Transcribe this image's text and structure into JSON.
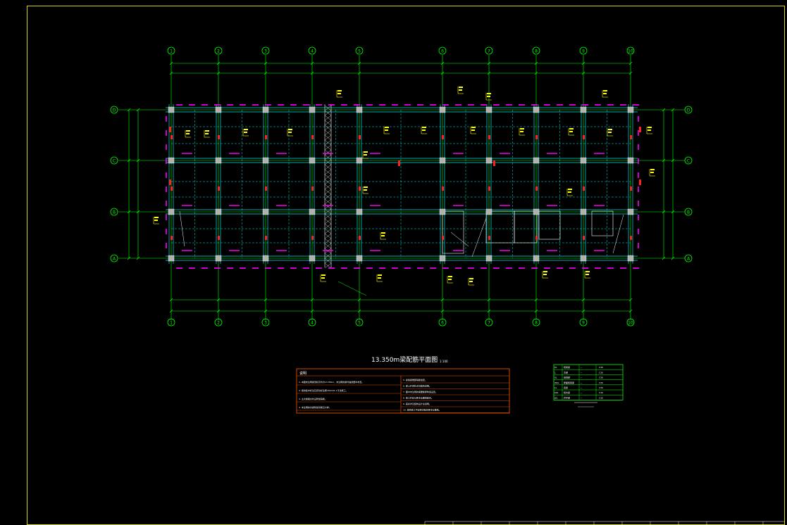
{
  "drawing": {
    "title": "13.350m梁配筋平面图",
    "title_scale": "1:100",
    "colors": {
      "background": "#000000",
      "frame": "#d8d800",
      "grid_line": "#00ff00",
      "bubble": "#00ff00",
      "beam": "#00e0e0",
      "rebar_note": "#ff00ff",
      "annotation": "#ffff00",
      "column": "#b0b0b0",
      "table_border": "#ff5a00",
      "legend_table": "#00ff00",
      "text": "#ffffff"
    },
    "axis_bubbles_horizontal": [
      "1",
      "2",
      "3",
      "4",
      "5",
      "6",
      "7",
      "8",
      "9",
      "10"
    ],
    "axis_bubbles_vertical": [
      "D",
      "C",
      "B",
      "A"
    ]
  },
  "notes_table": {
    "header": "说明",
    "left_rows": [
      "1. 本图未注明梁顶标高均为13.350m，未注明的梁均轴线居中布置。",
      "2. 梁的集中标注及原位标注按16G101-1平法施工。",
      "3. 主次梁相交处设附加箍筋。",
      "4. 未注明的次梁附加吊筋见大样。"
    ],
    "right_rows": [
      "5. 悬挑梁端部箍筋加密。",
      "6. 梁上开洞处详见结构说明。",
      "7. 图中未注明的梁腰筋按构造设置。",
      "8. 施工时应与各专业图纸配合。",
      "9. 其余详见结构设计总说明。",
      "10. 结构施工中应密切配合各专业图纸。"
    ]
  },
  "legend_table": {
    "rows": [
      [
        "KL",
        "框架梁",
        "--",
        "C30"
      ],
      [
        "L",
        "次梁",
        "--",
        "C30"
      ],
      [
        "XL",
        "悬挑梁",
        "--",
        "C30"
      ],
      [
        "WKL",
        "屋面框架梁",
        "--",
        "C30"
      ],
      [
        "LL",
        "连梁",
        "--",
        "C30"
      ],
      [
        "KZL",
        "框支梁",
        "--",
        "C30"
      ],
      [
        "JZL",
        "井字梁",
        "--",
        "C30"
      ]
    ]
  }
}
